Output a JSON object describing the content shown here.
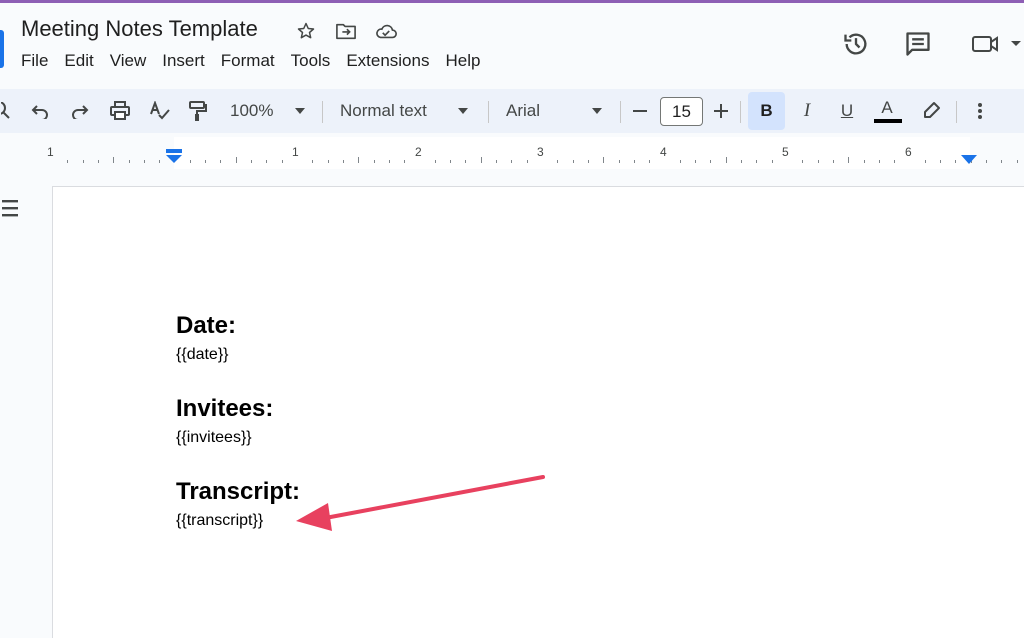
{
  "document": {
    "title": "Meeting Notes Template"
  },
  "menu": {
    "items": [
      "File",
      "Edit",
      "View",
      "Insert",
      "Format",
      "Tools",
      "Extensions",
      "Help"
    ]
  },
  "toolbar": {
    "zoom": "100%",
    "style": "Normal text",
    "font": "Arial",
    "font_size": "15",
    "bold_label": "B",
    "italic_label": "I",
    "underline_label": "U",
    "text_color_label": "A"
  },
  "ruler": {
    "labels": [
      "1",
      "1",
      "2",
      "3",
      "4",
      "5",
      "6"
    ]
  },
  "content": {
    "date_heading": "Date:",
    "date_value": "{{date}}",
    "invitees_heading": "Invitees:",
    "invitees_value": "{{invitees}}",
    "transcript_heading": "Transcript:",
    "transcript_value": "{{transcript}}"
  },
  "icons": {
    "star": "star-icon",
    "move": "move-to-folder-icon",
    "cloud": "cloud-saved-icon",
    "history": "history-icon",
    "comments": "comments-icon",
    "meet": "video-call-icon",
    "outline": "outline-icon",
    "arrow": "annotation-arrow"
  },
  "colors": {
    "accent": "#1a73e8",
    "arrow": "#e8415f",
    "toolbar_bg": "#edf2fa",
    "bold_active_bg": "#d3e3fd",
    "top_strip": "#8e5fb5"
  }
}
